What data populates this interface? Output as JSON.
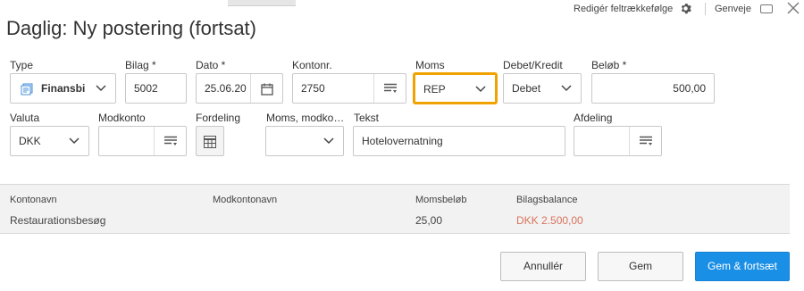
{
  "header": {
    "title": "Daglig: Ny postering (fortsat)",
    "edit_order_label": "Redigér feltrækkefølge",
    "shortcuts_label": "Genveje"
  },
  "row1": {
    "type": {
      "label": "Type",
      "value": "Finansbi"
    },
    "bilag": {
      "label": "Bilag *",
      "value": "5002"
    },
    "dato": {
      "label": "Dato *",
      "value": "25.06.20"
    },
    "kontonr": {
      "label": "Kontonr.",
      "value": "2750"
    },
    "moms": {
      "label": "Moms",
      "value": "REP"
    },
    "debet_kredit": {
      "label": "Debet/Kredit",
      "value": "Debet"
    },
    "belob": {
      "label": "Beløb *",
      "value": "500,00"
    }
  },
  "row2": {
    "valuta": {
      "label": "Valuta",
      "value": "DKK"
    },
    "modkonto": {
      "label": "Modkonto",
      "value": ""
    },
    "fordeling": {
      "label": "Fordeling"
    },
    "moms_modkonto": {
      "label": "Moms, modko…",
      "value": ""
    },
    "tekst": {
      "label": "Tekst",
      "value": "Hotelovernatning"
    },
    "afdeling": {
      "label": "Afdeling",
      "value": ""
    }
  },
  "summary": {
    "headers": {
      "kontonavn": "Kontonavn",
      "modkontonavn": "Modkontonavn",
      "momsbelob": "Momsbeløb",
      "bilagsbalance": "Bilagsbalance"
    },
    "values": {
      "kontonavn": "Restaurationsbesøg",
      "modkontonavn": "",
      "momsbelob": "25,00",
      "bilagsbalance": "DKK 2.500,00"
    }
  },
  "buttons": {
    "cancel": "Annullér",
    "save": "Gem",
    "save_continue": "Gem & fortsæt"
  },
  "colors": {
    "focus_border": "#f0a200",
    "primary_button": "#1a8fe6",
    "balance_text": "#d9735c"
  },
  "icons": {
    "settings": "gear-icon",
    "keyboard": "keyboard-icon",
    "close": "close-icon",
    "type": "document-stack-icon",
    "calendar": "calendar-icon",
    "lookup": "list-lookup-icon",
    "distribution": "grid-icon",
    "dropdown": "chevron-down-icon"
  }
}
